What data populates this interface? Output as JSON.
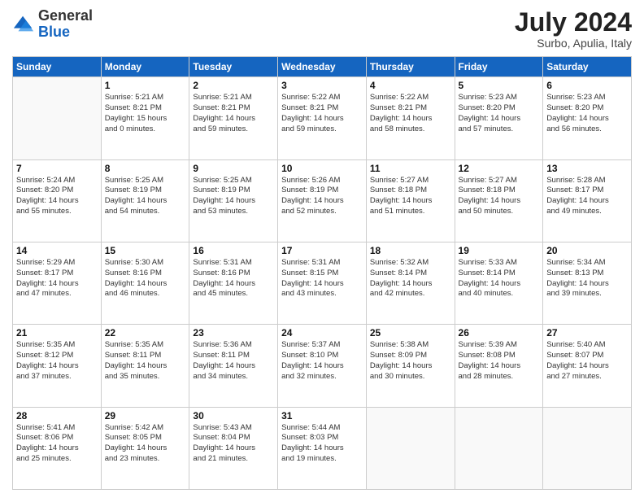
{
  "header": {
    "logo": {
      "general": "General",
      "blue": "Blue"
    },
    "title": "July 2024",
    "subtitle": "Surbo, Apulia, Italy"
  },
  "days_of_week": [
    "Sunday",
    "Monday",
    "Tuesday",
    "Wednesday",
    "Thursday",
    "Friday",
    "Saturday"
  ],
  "weeks": [
    [
      {
        "day": "",
        "info": ""
      },
      {
        "day": "1",
        "info": "Sunrise: 5:21 AM\nSunset: 8:21 PM\nDaylight: 15 hours\nand 0 minutes."
      },
      {
        "day": "2",
        "info": "Sunrise: 5:21 AM\nSunset: 8:21 PM\nDaylight: 14 hours\nand 59 minutes."
      },
      {
        "day": "3",
        "info": "Sunrise: 5:22 AM\nSunset: 8:21 PM\nDaylight: 14 hours\nand 59 minutes."
      },
      {
        "day": "4",
        "info": "Sunrise: 5:22 AM\nSunset: 8:21 PM\nDaylight: 14 hours\nand 58 minutes."
      },
      {
        "day": "5",
        "info": "Sunrise: 5:23 AM\nSunset: 8:20 PM\nDaylight: 14 hours\nand 57 minutes."
      },
      {
        "day": "6",
        "info": "Sunrise: 5:23 AM\nSunset: 8:20 PM\nDaylight: 14 hours\nand 56 minutes."
      }
    ],
    [
      {
        "day": "7",
        "info": "Sunrise: 5:24 AM\nSunset: 8:20 PM\nDaylight: 14 hours\nand 55 minutes."
      },
      {
        "day": "8",
        "info": "Sunrise: 5:25 AM\nSunset: 8:19 PM\nDaylight: 14 hours\nand 54 minutes."
      },
      {
        "day": "9",
        "info": "Sunrise: 5:25 AM\nSunset: 8:19 PM\nDaylight: 14 hours\nand 53 minutes."
      },
      {
        "day": "10",
        "info": "Sunrise: 5:26 AM\nSunset: 8:19 PM\nDaylight: 14 hours\nand 52 minutes."
      },
      {
        "day": "11",
        "info": "Sunrise: 5:27 AM\nSunset: 8:18 PM\nDaylight: 14 hours\nand 51 minutes."
      },
      {
        "day": "12",
        "info": "Sunrise: 5:27 AM\nSunset: 8:18 PM\nDaylight: 14 hours\nand 50 minutes."
      },
      {
        "day": "13",
        "info": "Sunrise: 5:28 AM\nSunset: 8:17 PM\nDaylight: 14 hours\nand 49 minutes."
      }
    ],
    [
      {
        "day": "14",
        "info": "Sunrise: 5:29 AM\nSunset: 8:17 PM\nDaylight: 14 hours\nand 47 minutes."
      },
      {
        "day": "15",
        "info": "Sunrise: 5:30 AM\nSunset: 8:16 PM\nDaylight: 14 hours\nand 46 minutes."
      },
      {
        "day": "16",
        "info": "Sunrise: 5:31 AM\nSunset: 8:16 PM\nDaylight: 14 hours\nand 45 minutes."
      },
      {
        "day": "17",
        "info": "Sunrise: 5:31 AM\nSunset: 8:15 PM\nDaylight: 14 hours\nand 43 minutes."
      },
      {
        "day": "18",
        "info": "Sunrise: 5:32 AM\nSunset: 8:14 PM\nDaylight: 14 hours\nand 42 minutes."
      },
      {
        "day": "19",
        "info": "Sunrise: 5:33 AM\nSunset: 8:14 PM\nDaylight: 14 hours\nand 40 minutes."
      },
      {
        "day": "20",
        "info": "Sunrise: 5:34 AM\nSunset: 8:13 PM\nDaylight: 14 hours\nand 39 minutes."
      }
    ],
    [
      {
        "day": "21",
        "info": "Sunrise: 5:35 AM\nSunset: 8:12 PM\nDaylight: 14 hours\nand 37 minutes."
      },
      {
        "day": "22",
        "info": "Sunrise: 5:35 AM\nSunset: 8:11 PM\nDaylight: 14 hours\nand 35 minutes."
      },
      {
        "day": "23",
        "info": "Sunrise: 5:36 AM\nSunset: 8:11 PM\nDaylight: 14 hours\nand 34 minutes."
      },
      {
        "day": "24",
        "info": "Sunrise: 5:37 AM\nSunset: 8:10 PM\nDaylight: 14 hours\nand 32 minutes."
      },
      {
        "day": "25",
        "info": "Sunrise: 5:38 AM\nSunset: 8:09 PM\nDaylight: 14 hours\nand 30 minutes."
      },
      {
        "day": "26",
        "info": "Sunrise: 5:39 AM\nSunset: 8:08 PM\nDaylight: 14 hours\nand 28 minutes."
      },
      {
        "day": "27",
        "info": "Sunrise: 5:40 AM\nSunset: 8:07 PM\nDaylight: 14 hours\nand 27 minutes."
      }
    ],
    [
      {
        "day": "28",
        "info": "Sunrise: 5:41 AM\nSunset: 8:06 PM\nDaylight: 14 hours\nand 25 minutes."
      },
      {
        "day": "29",
        "info": "Sunrise: 5:42 AM\nSunset: 8:05 PM\nDaylight: 14 hours\nand 23 minutes."
      },
      {
        "day": "30",
        "info": "Sunrise: 5:43 AM\nSunset: 8:04 PM\nDaylight: 14 hours\nand 21 minutes."
      },
      {
        "day": "31",
        "info": "Sunrise: 5:44 AM\nSunset: 8:03 PM\nDaylight: 14 hours\nand 19 minutes."
      },
      {
        "day": "",
        "info": ""
      },
      {
        "day": "",
        "info": ""
      },
      {
        "day": "",
        "info": ""
      }
    ]
  ]
}
